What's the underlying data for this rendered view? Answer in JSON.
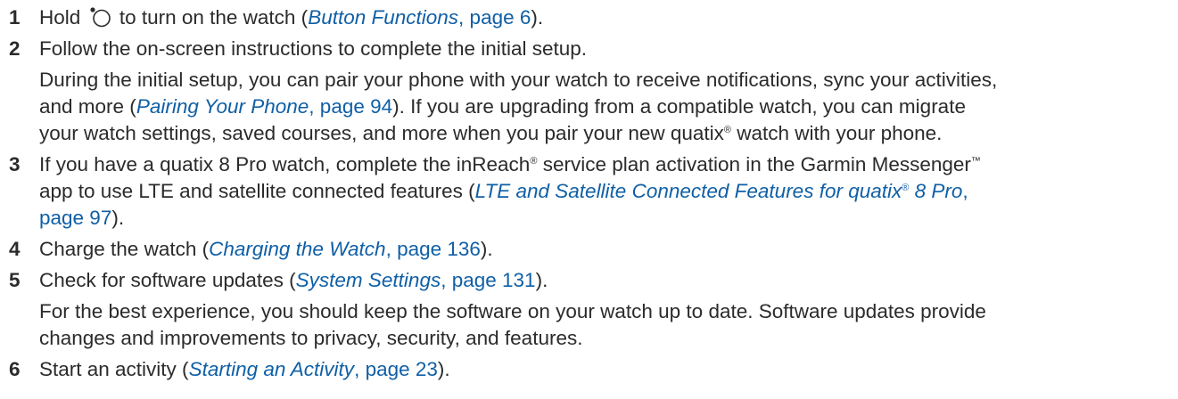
{
  "steps": [
    {
      "num": "1",
      "pre": "Hold",
      "post": "to turn on the watch (",
      "link_text": "Button Functions",
      "link_page": ", page 6",
      "end": ")."
    },
    {
      "num": "2",
      "text": "Follow the on-screen instructions to complete the initial setup.",
      "note_a": "During the initial setup, you can pair your phone with your watch to receive notifications, sync your activities,",
      "note_b1": "and more (",
      "note_b_link": "Pairing Your Phone",
      "note_b_page": ", page 94",
      "note_b2": "). If you are upgrading from a compatible watch, you can migrate",
      "note_c1": "your watch settings, saved courses, and more when you pair your new quatix",
      "note_c2": " watch with your phone."
    },
    {
      "num": "3",
      "a1": "If you have a quatix 8 Pro watch, complete the inReach",
      "a2": " service plan activation in the Garmin Messenger",
      "b1": "app to use LTE and satellite connected features (",
      "b_link1": "LTE and Satellite Connected Features for quatix",
      "b_link2": " 8 Pro",
      "b_page": ",",
      "c_page": "page 97",
      "c_end": ")."
    },
    {
      "num": "4",
      "pre": "Charge the watch (",
      "link_text": "Charging the Watch",
      "link_page": ", page 136",
      "end": ")."
    },
    {
      "num": "5",
      "pre": "Check for software updates (",
      "link_text": "System Settings",
      "link_page": ", page 131",
      "end": ").",
      "note_a": "For the best experience, you should keep the software on your watch up to date. Software updates provide",
      "note_b": "changes and improvements to privacy, security, and features."
    },
    {
      "num": "6",
      "pre": "Start an activity (",
      "link_text": "Starting an Activity",
      "link_page": ", page 23",
      "end": ")."
    }
  ],
  "symbols": {
    "registered": "®",
    "trademark": "™"
  },
  "icons": {
    "power_button": "watch-button-icon"
  }
}
